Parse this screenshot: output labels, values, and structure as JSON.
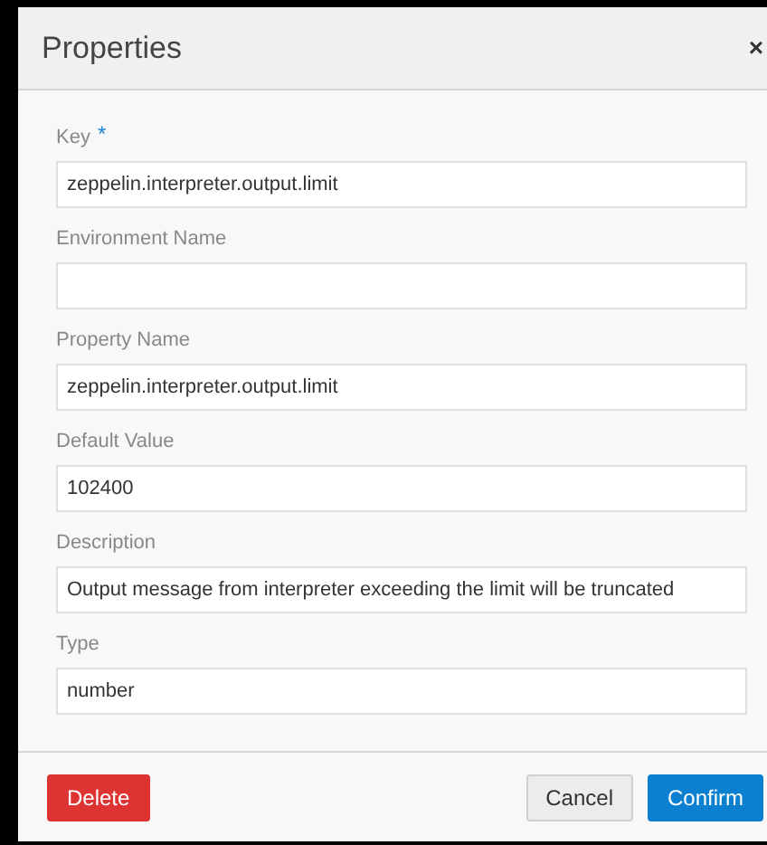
{
  "dialog": {
    "title": "Properties",
    "close": "×"
  },
  "fields": [
    {
      "label": "Key",
      "required_mark": "*",
      "value": "zeppelin.interpreter.output.limit"
    },
    {
      "label": "Environment Name"
    },
    {
      "label": "Property Name",
      "value": "zeppelin.interpreter.output.limit"
    },
    {
      "label": "Default Value",
      "value": "102400"
    },
    {
      "label": "Description",
      "value": "Output message from interpreter exceeding the limit will be truncated"
    },
    {
      "label": "Type",
      "value": "number"
    }
  ],
  "buttons": [
    {
      "label": "Delete",
      "kind": "danger"
    },
    {
      "label": "Cancel",
      "kind": "default"
    },
    {
      "label": "Confirm",
      "kind": "primary"
    }
  ]
}
